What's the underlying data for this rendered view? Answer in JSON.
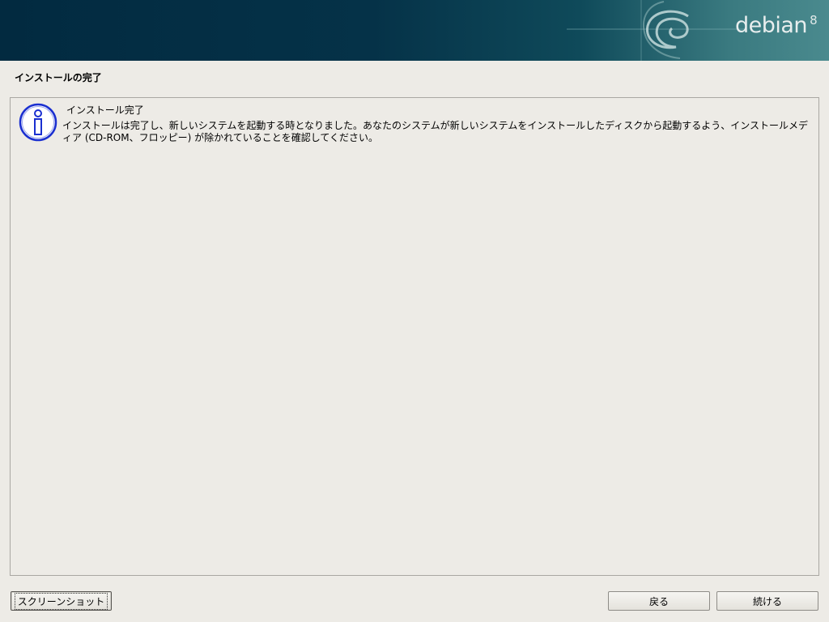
{
  "banner": {
    "brand": "debian",
    "version": "8",
    "colors": {
      "left": "#022a40",
      "right": "#4a8a8e"
    }
  },
  "page": {
    "title": "インストールの完了"
  },
  "message": {
    "icon": "info-icon",
    "heading": "インストール完了",
    "body": "インストールは完了し、新しいシステムを起動する時となりました。あなたのシステムが新しいシステムをインストールしたディスクから起動するよう、インストールメディア (CD-ROM、フロッピー) が除かれていることを確認してください。"
  },
  "buttons": {
    "screenshot": "スクリーンショット",
    "back": "戻る",
    "continue": "続ける"
  },
  "colors": {
    "background": "#edebe6",
    "info_icon": "#1a2fd0"
  }
}
